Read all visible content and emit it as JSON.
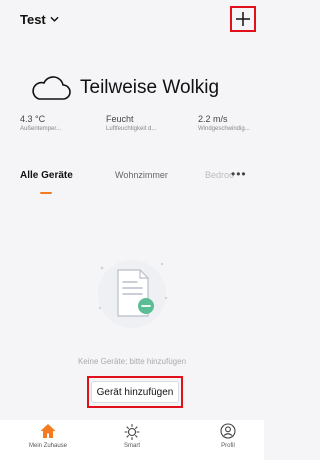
{
  "header": {
    "home_name": "Test",
    "add_icon": "plus-icon"
  },
  "weather": {
    "icon": "cloud-icon",
    "condition": "Teilweise Wolkig",
    "stats": [
      {
        "value": "4.3 °C",
        "label": "Außentemper..."
      },
      {
        "value": "Feucht",
        "label": "Luftfeuchtigkeit d..."
      },
      {
        "value": "2.2 m/s",
        "label": "Windgeschwindig..."
      }
    ]
  },
  "tabs": [
    {
      "label": "Alle Geräte",
      "active": true
    },
    {
      "label": "Wohnzimmer",
      "active": false
    },
    {
      "label": "Bedroo",
      "active": false
    }
  ],
  "empty": {
    "message": "Keine Geräte; bitte hinzufügen",
    "button_label": "Gerät hinzufügen"
  },
  "bottom_nav": [
    {
      "label": "Mein Zuhause",
      "icon": "home-icon",
      "active": true
    },
    {
      "label": "Smart",
      "icon": "sun-icon",
      "active": false
    },
    {
      "label": "Profil",
      "icon": "profile-icon",
      "active": false
    }
  ],
  "colors": {
    "accent": "#f47b20",
    "highlight_box": "#e1101a",
    "background": "#f5f5f7"
  }
}
